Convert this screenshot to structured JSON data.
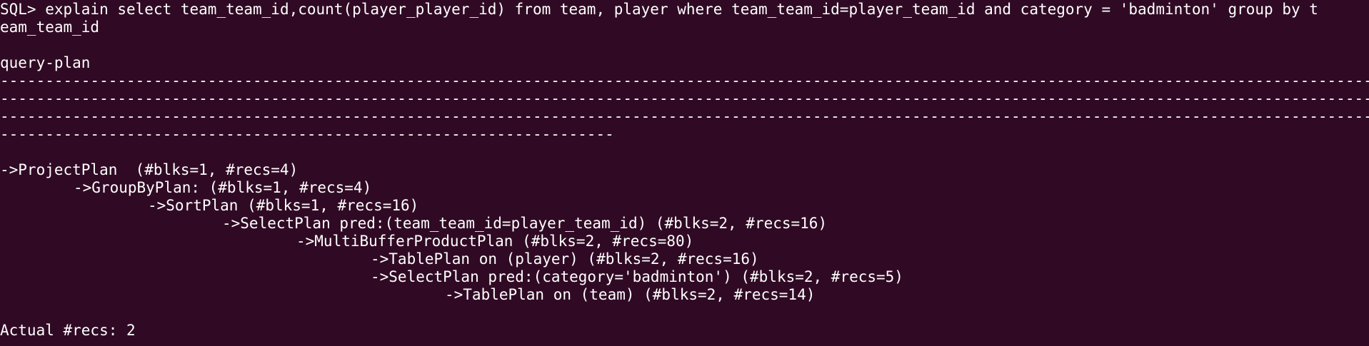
{
  "prompt": "SQL>",
  "command_line1": " explain select team_team_id,count(player_player_id) from team, player where team_team_id=player_team_id and category = 'badminton' group by t",
  "command_line2": "eam_team_id",
  "header": "query-plan",
  "separator": {
    "line1": "------------------------------------------------------------------------------------------------------------------------------------------------------------------",
    "line2": "------------------------------------------------------------------------------------------------------------------------------------------------------------------",
    "line3": "------------------------------------------------------------------------------------------------------------------------------------------------------------------",
    "line4": "--------------------------------------------------------------------"
  },
  "plan": [
    {
      "text": "->ProjectPlan  (#blks=1, #recs=4)"
    },
    {
      "text": "->GroupByPlan: (#blks=1, #recs=4)"
    },
    {
      "text": "->SortPlan (#blks=1, #recs=16)"
    },
    {
      "text": "->SelectPlan pred:(team_team_id=player_team_id) (#blks=2, #recs=16)"
    },
    {
      "text": "->MultiBufferProductPlan (#blks=2, #recs=80)"
    },
    {
      "text": "->TablePlan on (player) (#blks=2, #recs=16)"
    },
    {
      "text": "->SelectPlan pred:(category='badminton') (#blks=2, #recs=5)"
    },
    {
      "text": "->TablePlan on (team) (#blks=2, #recs=14)"
    }
  ],
  "result": "Actual #recs: 2",
  "colors": {
    "background": "#300a24",
    "foreground": "#ffffff"
  }
}
